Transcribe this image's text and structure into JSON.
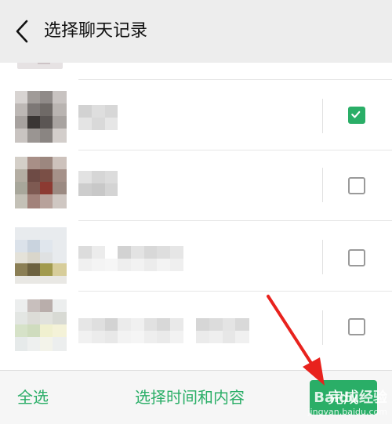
{
  "header": {
    "title": "选择聊天记录"
  },
  "icons": {
    "back": "chevron-left-icon"
  },
  "colors": {
    "accent": "#2aae67",
    "header_bg": "#ededed",
    "footer_bg": "#f6f6f6"
  },
  "rows": [
    {
      "selected": false
    },
    {
      "selected": true
    },
    {
      "selected": false
    },
    {
      "selected": false
    },
    {
      "selected": false
    }
  ],
  "footer": {
    "select_all": "全选",
    "select_time_content": "选择时间和内容",
    "done": "完成"
  },
  "watermark": {
    "brand": "Baidu经验",
    "url": "jingyan.baidu.com"
  }
}
